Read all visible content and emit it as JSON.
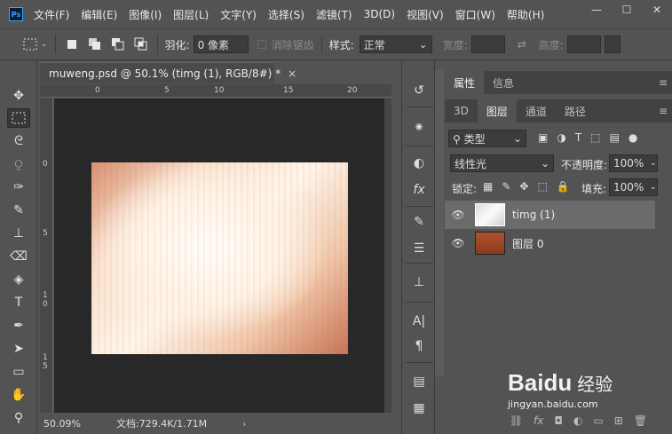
{
  "app": {
    "logo_text": "Ps"
  },
  "menu": [
    "文件(F)",
    "编辑(E)",
    "图像(I)",
    "图层(L)",
    "文字(Y)",
    "选择(S)",
    "滤镜(T)",
    "3D(D)",
    "视图(V)",
    "窗口(W)",
    "帮助(H)"
  ],
  "window_controls": {
    "minimize": "—",
    "maximize": "☐",
    "close": "✕"
  },
  "options": {
    "feather_label": "羽化:",
    "feather_value": "0 像素",
    "antialias_label": "消除锯齿",
    "style_label": "样式:",
    "style_value": "正常",
    "width_label": "宽度:",
    "height_label": "高度:"
  },
  "document": {
    "tab_title": "muweng.psd @ 50.1% (timg (1), RGB/8#) *",
    "close_glyph": "×",
    "ruler_top": [
      "0",
      "5",
      "10",
      "15",
      "20"
    ],
    "ruler_left": [
      "0",
      "5",
      "1\n0",
      "1\n5"
    ],
    "zoom": "50.09%",
    "doc_info": "文档:729.4K/1.71M"
  },
  "panels": {
    "top_tabs": [
      "属性",
      "信息"
    ],
    "layer_tabs": [
      "3D",
      "图层",
      "通道",
      "路径"
    ],
    "filter_kind": "类型",
    "blend_mode": "线性光",
    "opacity_label": "不透明度:",
    "opacity_value": "100%",
    "lock_label": "锁定:",
    "fill_label": "填充:",
    "fill_value": "100%",
    "layers": [
      {
        "name": "timg (1)",
        "selected": true
      },
      {
        "name": "图层 0",
        "selected": false
      }
    ]
  },
  "watermark": {
    "brand": "Baidu",
    "cn": "经验",
    "url": "jingyan.baidu.com"
  },
  "colors": {
    "bg": "#535353",
    "dark": "#282828",
    "accent": "#31a8ff"
  }
}
